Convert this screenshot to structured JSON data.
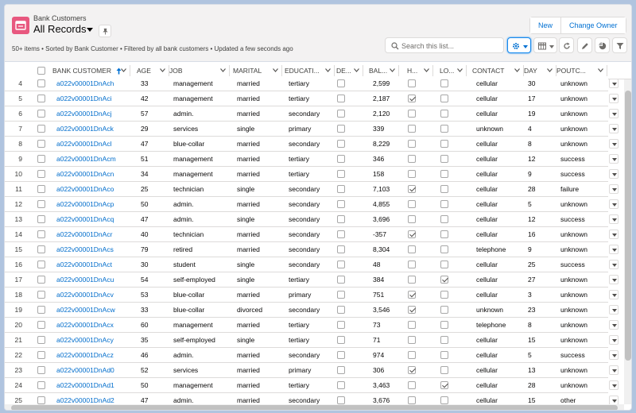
{
  "header": {
    "object_label": "Bank Customers",
    "title": "All Records",
    "subtitle": "50+ items • Sorted by Bank Customer • Filtered by all bank customers • Updated a few seconds ago",
    "new_label": "New",
    "change_owner_label": "Change Owner",
    "search_placeholder": "Search this list..."
  },
  "colors": {
    "accent": "#0070d2",
    "object_icon": "#e8587f",
    "link": "#006dcc"
  },
  "icons": [
    "table-icon",
    "caret-down-icon",
    "pin-icon",
    "search-icon",
    "gear-icon",
    "table-view-icon",
    "refresh-icon",
    "edit-pencil-icon",
    "pie-chart-icon",
    "filter-icon"
  ],
  "columns": {
    "name": "BANK CUSTOMER",
    "age": "AGE",
    "job": "JOB",
    "marital": "MARITAL",
    "education": "EDUCATI...",
    "default": "DE...",
    "balance": "BAL...",
    "housing": "H...",
    "loan": "LO...",
    "contact": "CONTACT",
    "day": "DAY",
    "poutcome": "POUTC..."
  },
  "rows": [
    {
      "n": "4",
      "name": "a022v00001DnAch",
      "age": "33",
      "job": "management",
      "marital": "married",
      "education": "tertiary",
      "default": false,
      "balance": "2,599",
      "housing": false,
      "loan": false,
      "contact": "cellular",
      "day": "30",
      "poutcome": "unknown"
    },
    {
      "n": "5",
      "name": "a022v00001DnAci",
      "age": "42",
      "job": "management",
      "marital": "married",
      "education": "tertiary",
      "default": false,
      "balance": "2,187",
      "housing": true,
      "loan": false,
      "contact": "cellular",
      "day": "17",
      "poutcome": "unknown"
    },
    {
      "n": "6",
      "name": "a022v00001DnAcj",
      "age": "57",
      "job": "admin.",
      "marital": "married",
      "education": "secondary",
      "default": false,
      "balance": "2,120",
      "housing": false,
      "loan": false,
      "contact": "cellular",
      "day": "19",
      "poutcome": "unknown"
    },
    {
      "n": "7",
      "name": "a022v00001DnAck",
      "age": "29",
      "job": "services",
      "marital": "single",
      "education": "primary",
      "default": false,
      "balance": "339",
      "housing": false,
      "loan": false,
      "contact": "unknown",
      "day": "4",
      "poutcome": "unknown"
    },
    {
      "n": "8",
      "name": "a022v00001DnAcl",
      "age": "47",
      "job": "blue-collar",
      "marital": "married",
      "education": "secondary",
      "default": false,
      "balance": "8,229",
      "housing": false,
      "loan": false,
      "contact": "cellular",
      "day": "8",
      "poutcome": "unknown"
    },
    {
      "n": "9",
      "name": "a022v00001DnAcm",
      "age": "51",
      "job": "management",
      "marital": "married",
      "education": "tertiary",
      "default": false,
      "balance": "346",
      "housing": false,
      "loan": false,
      "contact": "cellular",
      "day": "12",
      "poutcome": "success"
    },
    {
      "n": "10",
      "name": "a022v00001DnAcn",
      "age": "34",
      "job": "management",
      "marital": "married",
      "education": "tertiary",
      "default": false,
      "balance": "158",
      "housing": false,
      "loan": false,
      "contact": "cellular",
      "day": "9",
      "poutcome": "success"
    },
    {
      "n": "11",
      "name": "a022v00001DnAco",
      "age": "25",
      "job": "technician",
      "marital": "single",
      "education": "secondary",
      "default": false,
      "balance": "7,103",
      "housing": true,
      "loan": false,
      "contact": "cellular",
      "day": "28",
      "poutcome": "failure"
    },
    {
      "n": "12",
      "name": "a022v00001DnAcp",
      "age": "50",
      "job": "admin.",
      "marital": "married",
      "education": "secondary",
      "default": false,
      "balance": "4,855",
      "housing": false,
      "loan": false,
      "contact": "cellular",
      "day": "5",
      "poutcome": "unknown"
    },
    {
      "n": "13",
      "name": "a022v00001DnAcq",
      "age": "47",
      "job": "admin.",
      "marital": "single",
      "education": "secondary",
      "default": false,
      "balance": "3,696",
      "housing": false,
      "loan": false,
      "contact": "cellular",
      "day": "12",
      "poutcome": "success"
    },
    {
      "n": "14",
      "name": "a022v00001DnAcr",
      "age": "40",
      "job": "technician",
      "marital": "married",
      "education": "secondary",
      "default": false,
      "balance": "-357",
      "housing": true,
      "loan": false,
      "contact": "cellular",
      "day": "16",
      "poutcome": "unknown"
    },
    {
      "n": "15",
      "name": "a022v00001DnAcs",
      "age": "79",
      "job": "retired",
      "marital": "married",
      "education": "secondary",
      "default": false,
      "balance": "8,304",
      "housing": false,
      "loan": false,
      "contact": "telephone",
      "day": "9",
      "poutcome": "unknown"
    },
    {
      "n": "16",
      "name": "a022v00001DnAct",
      "age": "30",
      "job": "student",
      "marital": "single",
      "education": "secondary",
      "default": false,
      "balance": "48",
      "housing": false,
      "loan": false,
      "contact": "cellular",
      "day": "25",
      "poutcome": "success"
    },
    {
      "n": "17",
      "name": "a022v00001DnAcu",
      "age": "54",
      "job": "self-employed",
      "marital": "single",
      "education": "tertiary",
      "default": false,
      "balance": "384",
      "housing": false,
      "loan": true,
      "contact": "cellular",
      "day": "27",
      "poutcome": "unknown"
    },
    {
      "n": "18",
      "name": "a022v00001DnAcv",
      "age": "53",
      "job": "blue-collar",
      "marital": "married",
      "education": "primary",
      "default": false,
      "balance": "751",
      "housing": true,
      "loan": false,
      "contact": "cellular",
      "day": "3",
      "poutcome": "unknown"
    },
    {
      "n": "19",
      "name": "a022v00001DnAcw",
      "age": "33",
      "job": "blue-collar",
      "marital": "divorced",
      "education": "secondary",
      "default": false,
      "balance": "3,546",
      "housing": true,
      "loan": false,
      "contact": "unknown",
      "day": "23",
      "poutcome": "unknown"
    },
    {
      "n": "20",
      "name": "a022v00001DnAcx",
      "age": "60",
      "job": "management",
      "marital": "married",
      "education": "tertiary",
      "default": false,
      "balance": "73",
      "housing": false,
      "loan": false,
      "contact": "telephone",
      "day": "8",
      "poutcome": "unknown"
    },
    {
      "n": "21",
      "name": "a022v00001DnAcy",
      "age": "35",
      "job": "self-employed",
      "marital": "single",
      "education": "tertiary",
      "default": false,
      "balance": "71",
      "housing": false,
      "loan": false,
      "contact": "cellular",
      "day": "15",
      "poutcome": "unknown"
    },
    {
      "n": "22",
      "name": "a022v00001DnAcz",
      "age": "46",
      "job": "admin.",
      "marital": "married",
      "education": "secondary",
      "default": false,
      "balance": "974",
      "housing": false,
      "loan": false,
      "contact": "cellular",
      "day": "5",
      "poutcome": "success"
    },
    {
      "n": "23",
      "name": "a022v00001DnAd0",
      "age": "52",
      "job": "services",
      "marital": "married",
      "education": "primary",
      "default": false,
      "balance": "306",
      "housing": true,
      "loan": false,
      "contact": "cellular",
      "day": "13",
      "poutcome": "unknown"
    },
    {
      "n": "24",
      "name": "a022v00001DnAd1",
      "age": "50",
      "job": "management",
      "marital": "married",
      "education": "tertiary",
      "default": false,
      "balance": "3,463",
      "housing": false,
      "loan": true,
      "contact": "cellular",
      "day": "28",
      "poutcome": "unknown"
    },
    {
      "n": "25",
      "name": "a022v00001DnAd2",
      "age": "47",
      "job": "admin.",
      "marital": "married",
      "education": "secondary",
      "default": false,
      "balance": "3,676",
      "housing": false,
      "loan": false,
      "contact": "cellular",
      "day": "15",
      "poutcome": "other"
    }
  ]
}
